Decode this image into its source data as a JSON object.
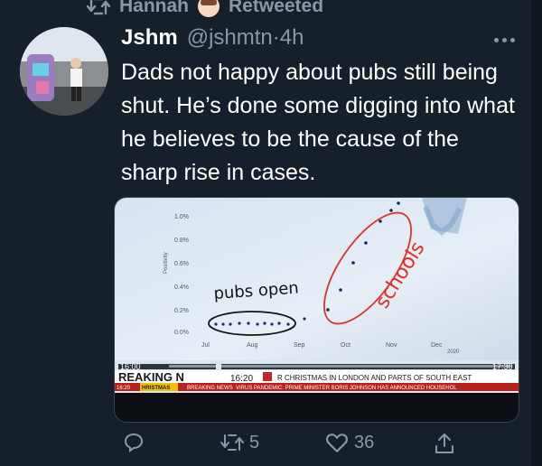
{
  "retweet": {
    "user": "Hannah",
    "label": "Retweeted"
  },
  "tweet": {
    "display_name": "Jshm",
    "handle": "@jshmtn",
    "separator": "·",
    "time": "4h",
    "text": "Dads not happy about pubs still being shut. He’s done some digging into what he believes to be the cause of the sharp rise in cases."
  },
  "media": {
    "y_ticks": [
      "1.0%",
      "0.8%",
      "0.6%",
      "0.4%",
      "0.2%",
      "0.0%"
    ],
    "y_axis_label": "Positivity",
    "x_ticks": [
      "Jul",
      "Aug",
      "Sep",
      "Oct",
      "Nov",
      "Dec"
    ],
    "x_year": "2020",
    "annotation_pubs": "pubs open",
    "annotation_schools": "schools",
    "ticker": {
      "time_left": "16:00",
      "time_right": "17:30",
      "breaking": "REAKING N",
      "clock": "16:20",
      "headline": "R CHRISTMAS IN LONDON AND PARTS OF SOUTH EAST",
      "strip_time": "16:20",
      "strip_1": "HRISTMAS",
      "strip_2": "BREAKING NEWS",
      "strip_3": "VIRUS PANDEMIC: PRIME MINISTER BORIS JOHNSON HAS ANNOUNCED HOUSEHOL"
    }
  },
  "actions": {
    "reply_count": "",
    "retweet_count": "5",
    "like_count": "36"
  },
  "colors": {
    "background": "#15202b",
    "secondary_text": "#8899a6",
    "annotation_red": "#e0302a"
  }
}
